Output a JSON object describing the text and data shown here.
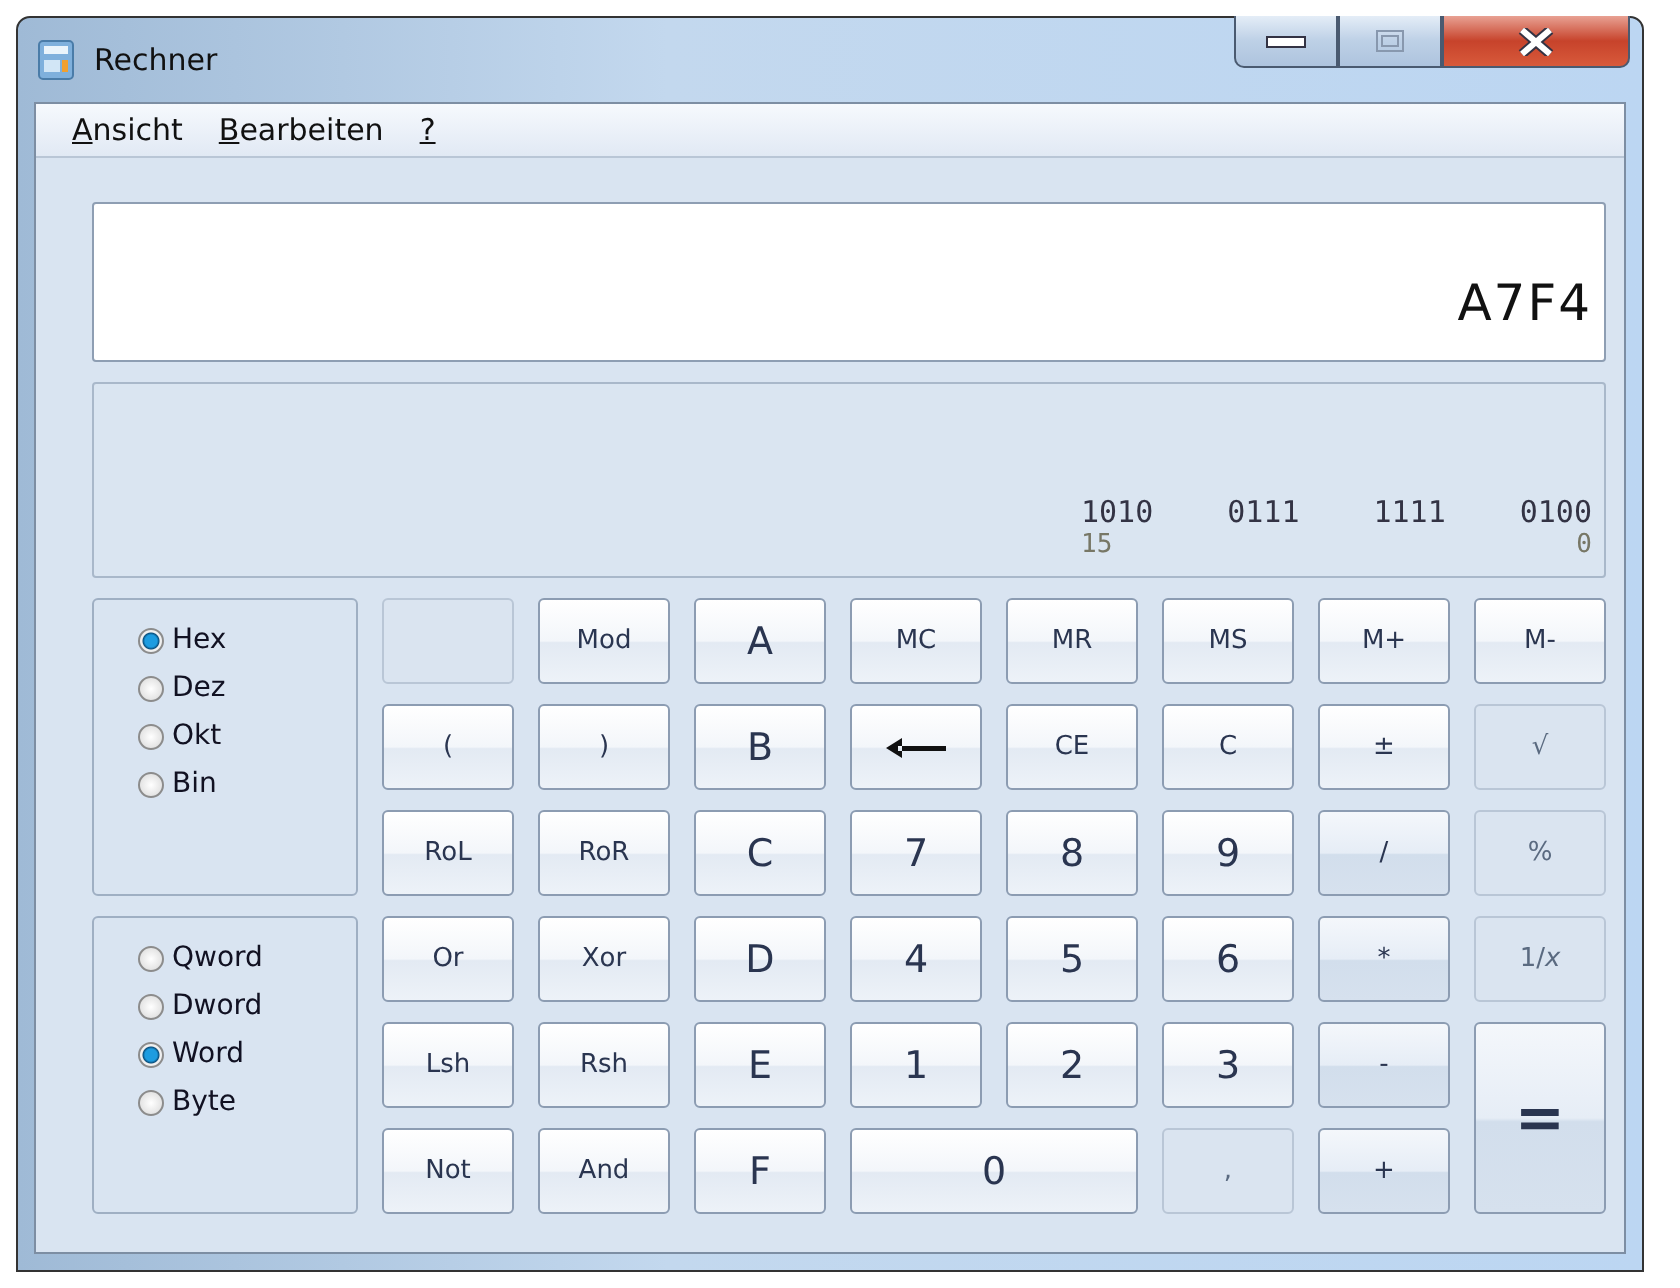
{
  "window": {
    "title": "Rechner"
  },
  "menu": [
    {
      "label": "Ansicht",
      "first_letter_underlined": true
    },
    {
      "label": "Bearbeiten",
      "first_letter_underlined": true
    },
    {
      "label": "?",
      "first_letter_underlined": true
    }
  ],
  "display": {
    "value": "A7F4"
  },
  "binary": {
    "groups": [
      "1010",
      "0111",
      "1111",
      "0100"
    ],
    "left_index": "15",
    "right_index": "0"
  },
  "base": [
    {
      "label": "Hex",
      "selected": true
    },
    {
      "label": "Dez",
      "selected": false
    },
    {
      "label": "Okt",
      "selected": false
    },
    {
      "label": "Bin",
      "selected": false
    }
  ],
  "word_size": [
    {
      "label": "Qword",
      "selected": false
    },
    {
      "label": "Dword",
      "selected": false
    },
    {
      "label": "Word",
      "selected": true
    },
    {
      "label": "Byte",
      "selected": false
    }
  ],
  "buttons": [
    {
      "kind": "blank",
      "disabled": true
    },
    {
      "label": "Mod",
      "kind": "func",
      "disabled": false
    },
    {
      "label": "A",
      "kind": "digit",
      "disabled": false
    },
    {
      "label": "MC",
      "kind": "func",
      "disabled": false
    },
    {
      "label": "MR",
      "kind": "func",
      "disabled": false
    },
    {
      "label": "MS",
      "kind": "func",
      "disabled": false
    },
    {
      "label": "M+",
      "kind": "func",
      "disabled": false
    },
    {
      "label": "M-",
      "kind": "func",
      "disabled": false
    },
    {
      "label": "(",
      "kind": "func",
      "disabled": false
    },
    {
      "label": ")",
      "kind": "func",
      "disabled": false
    },
    {
      "label": "B",
      "kind": "digit",
      "disabled": false
    },
    {
      "kind": "backspace",
      "disabled": false
    },
    {
      "label": "CE",
      "kind": "func",
      "disabled": false
    },
    {
      "label": "C",
      "kind": "func",
      "disabled": false
    },
    {
      "label": "±",
      "kind": "func",
      "disabled": false
    },
    {
      "label": "√",
      "kind": "func",
      "disabled": true
    },
    {
      "label": "RoL",
      "kind": "func",
      "disabled": false
    },
    {
      "label": "RoR",
      "kind": "func",
      "disabled": false
    },
    {
      "label": "C",
      "kind": "digit",
      "disabled": false
    },
    {
      "label": "7",
      "kind": "digit",
      "disabled": false
    },
    {
      "label": "8",
      "kind": "digit",
      "disabled": false
    },
    {
      "label": "9",
      "kind": "digit",
      "disabled": false
    },
    {
      "label": "/",
      "kind": "op",
      "disabled": false
    },
    {
      "label": "%",
      "kind": "func",
      "disabled": true
    },
    {
      "label": "Or",
      "kind": "func",
      "disabled": false
    },
    {
      "label": "Xor",
      "kind": "func",
      "disabled": false
    },
    {
      "label": "D",
      "kind": "digit",
      "disabled": false
    },
    {
      "label": "4",
      "kind": "digit",
      "disabled": false
    },
    {
      "label": "5",
      "kind": "digit",
      "disabled": false
    },
    {
      "label": "6",
      "kind": "digit",
      "disabled": false
    },
    {
      "label": "*",
      "kind": "op",
      "disabled": false
    },
    {
      "label": "1/*x*",
      "kind": "func",
      "disabled": true
    },
    {
      "label": "Lsh",
      "kind": "func",
      "disabled": false
    },
    {
      "label": "Rsh",
      "kind": "func",
      "disabled": false
    },
    {
      "label": "E",
      "kind": "digit",
      "disabled": false
    },
    {
      "label": "1",
      "kind": "digit",
      "disabled": false
    },
    {
      "label": "2",
      "kind": "digit",
      "disabled": false
    },
    {
      "label": "3",
      "kind": "digit",
      "disabled": false
    },
    {
      "label": "-",
      "kind": "op",
      "disabled": false
    },
    {
      "label": "=",
      "kind": "equals",
      "disabled": false
    },
    {
      "label": "Not",
      "kind": "func",
      "disabled": false
    },
    {
      "label": "And",
      "kind": "func",
      "disabled": false
    },
    {
      "label": "F",
      "kind": "digit",
      "disabled": false
    },
    {
      "label": "0",
      "kind": "zero",
      "disabled": false
    },
    {
      "label": ",",
      "kind": "func",
      "disabled": true
    },
    {
      "label": "+",
      "kind": "op",
      "disabled": false
    }
  ]
}
